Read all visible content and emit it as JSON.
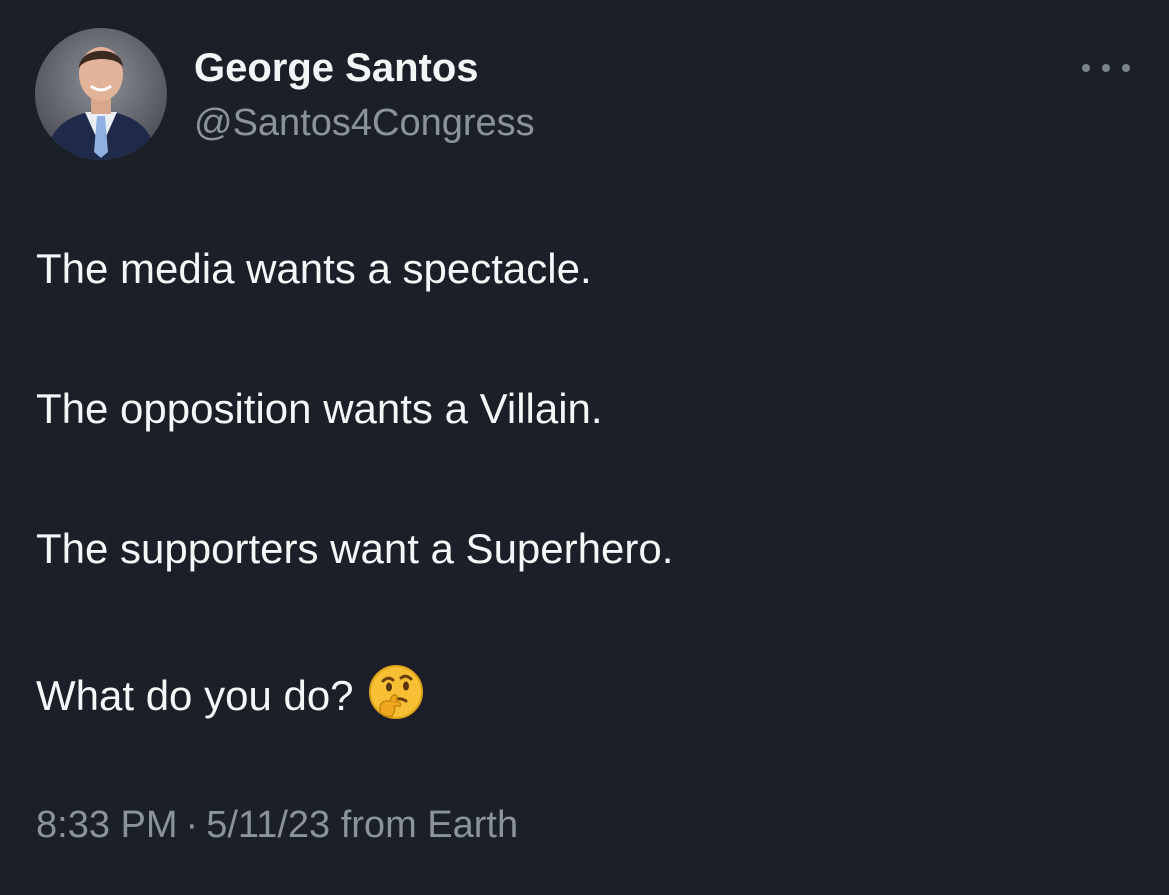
{
  "author": {
    "name": "George Santos",
    "handle": "@Santos4Congress"
  },
  "more_button": {
    "icon": "more-horizontal-icon"
  },
  "tweet": {
    "lines": [
      "The media wants a spectacle.",
      "The opposition wants a Villain.",
      "The supporters want a Superhero.",
      "What do you do?"
    ],
    "emoji": "thinking-face-emoji"
  },
  "meta": {
    "time": "8:33 PM",
    "separator": "·",
    "date": "5/11/23",
    "source": "from Earth"
  },
  "colors": {
    "background": "#1b1f28",
    "primary_text": "#f5f6f7",
    "secondary_text": "#8a939d"
  }
}
